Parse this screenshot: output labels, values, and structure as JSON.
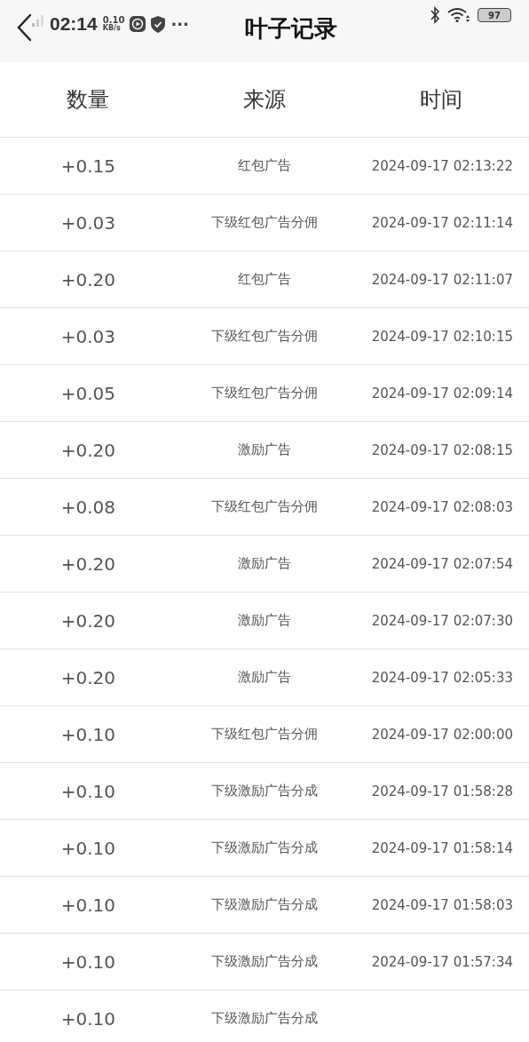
{
  "status_bar": {
    "time": "02:14",
    "net_speed": "0.10",
    "net_unit": "KB/s",
    "more": "···",
    "battery": "97"
  },
  "header": {
    "title": "叶子记录"
  },
  "table": {
    "columns": [
      "数量",
      "来源",
      "时间"
    ],
    "rows": [
      {
        "amount": "+0.15",
        "source": "红包广告",
        "time": "2024-09-17 02:13:22"
      },
      {
        "amount": "+0.03",
        "source": "下级红包广告分佣",
        "time": "2024-09-17 02:11:14"
      },
      {
        "amount": "+0.20",
        "source": "红包广告",
        "time": "2024-09-17 02:11:07"
      },
      {
        "amount": "+0.03",
        "source": "下级红包广告分佣",
        "time": "2024-09-17 02:10:15"
      },
      {
        "amount": "+0.05",
        "source": "下级红包广告分佣",
        "time": "2024-09-17 02:09:14"
      },
      {
        "amount": "+0.20",
        "source": "激励广告",
        "time": "2024-09-17 02:08:15"
      },
      {
        "amount": "+0.08",
        "source": "下级红包广告分佣",
        "time": "2024-09-17 02:08:03"
      },
      {
        "amount": "+0.20",
        "source": "激励广告",
        "time": "2024-09-17 02:07:54"
      },
      {
        "amount": "+0.20",
        "source": "激励广告",
        "time": "2024-09-17 02:07:30"
      },
      {
        "amount": "+0.20",
        "source": "激励广告",
        "time": "2024-09-17 02:05:33"
      },
      {
        "amount": "+0.10",
        "source": "下级红包广告分佣",
        "time": "2024-09-17 02:00:00"
      },
      {
        "amount": "+0.10",
        "source": "下级激励广告分成",
        "time": "2024-09-17 01:58:28"
      },
      {
        "amount": "+0.10",
        "source": "下级激励广告分成",
        "time": "2024-09-17 01:58:14"
      },
      {
        "amount": "+0.10",
        "source": "下级激励广告分成",
        "time": "2024-09-17 01:58:03"
      },
      {
        "amount": "+0.10",
        "source": "下级激励广告分成",
        "time": "2024-09-17 01:57:34"
      },
      {
        "amount": "+0.10",
        "source": "下级激励广告分成"
      }
    ]
  }
}
